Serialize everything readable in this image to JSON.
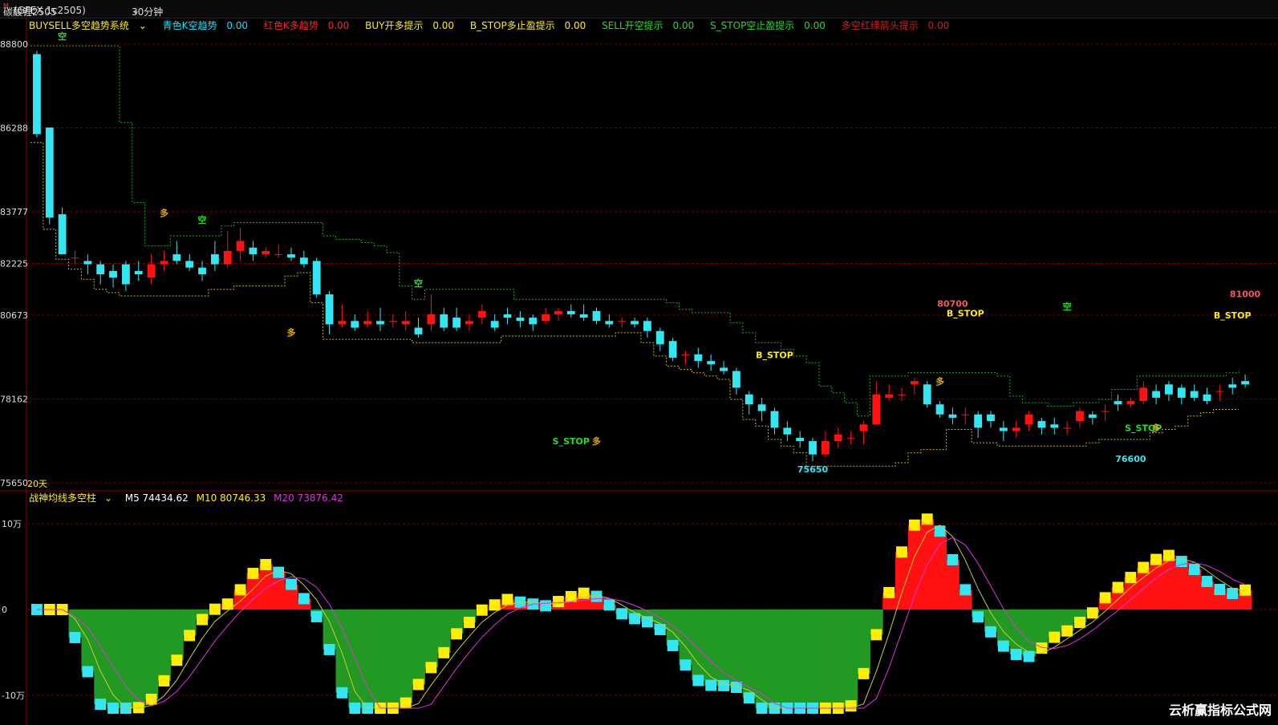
{
  "header": {
    "title": "碳酸锂2505",
    "title_superscript": "M",
    "contract": "(GFEX 1c2505)",
    "period": "30分钟"
  },
  "indicator_bar": {
    "system_name": "BUYSELL多空趋势系统",
    "items": [
      {
        "label": "青色K空趋势",
        "value": "0.00",
        "color": "#00e5ff"
      },
      {
        "label": "红色K多趋势",
        "value": "0.00",
        "color": "#ff2222"
      },
      {
        "label": "BUY开多提示",
        "value": "0.00",
        "color": "#ffee00"
      },
      {
        "label": "B_STOP多止盈提示",
        "value": "0.00",
        "color": "#ffee00"
      },
      {
        "label": "SELL开空提示",
        "value": "0.00",
        "color": "#22dd22"
      },
      {
        "label": "S_STOP空止盈提示",
        "value": "0.00",
        "color": "#22dd22"
      },
      {
        "label": "多空红绿箭头提示",
        "value": "0.00",
        "color": "#cc2222"
      }
    ]
  },
  "price_axis": [
    "88800",
    "86288",
    "83777",
    "82225",
    "80673",
    "78162",
    "75650"
  ],
  "period_label": "20天",
  "annotations": {
    "low1": "75650",
    "low2": "76600",
    "high1": "80700",
    "high2": "81000",
    "b_stop": "B_STOP",
    "s_stop": "S_STOP",
    "duo": "多",
    "kong": "空"
  },
  "sub_indicator": {
    "name": "战神均线多空柱",
    "m5": "M5 74434.62",
    "m10": "M10 80746.33",
    "m20": "M20 73876.42",
    "axis": [
      "10万",
      "0",
      "-10万"
    ]
  },
  "colors": {
    "up": "#ff1111",
    "down": "#33e6f2",
    "grid": "#7a0000",
    "yellow": "#ffee00",
    "green": "#229922",
    "magenta": "#dd33dd"
  },
  "watermark": "云析赢指标公式网",
  "chart_data": [
    {
      "type": "candlestick",
      "title": "碳酸锂2505 30分钟",
      "ylim": [
        75650,
        88800
      ],
      "candles": [
        [
          88500,
          86100,
          88600,
          86000
        ],
        [
          86300,
          83600,
          86300,
          83400
        ],
        [
          83700,
          82500,
          83900,
          82500
        ],
        [
          82400,
          82400,
          82600,
          82200
        ],
        [
          82300,
          82200,
          82500,
          81900
        ],
        [
          82200,
          81900,
          82300,
          81600
        ],
        [
          82000,
          81800,
          82200,
          81500
        ],
        [
          82200,
          81600,
          82300,
          81400
        ],
        [
          82000,
          81900,
          82300,
          81700
        ],
        [
          81800,
          82200,
          82500,
          81600
        ],
        [
          82200,
          82300,
          82600,
          82000
        ],
        [
          82500,
          82300,
          82900,
          82200
        ],
        [
          82300,
          82100,
          82500,
          82000
        ],
        [
          82100,
          81900,
          82300,
          81700
        ],
        [
          82500,
          82200,
          82900,
          82000
        ],
        [
          82200,
          82600,
          83200,
          82100
        ],
        [
          82600,
          82900,
          83300,
          82300
        ],
        [
          82700,
          82500,
          82900,
          82300
        ],
        [
          82500,
          82600,
          82700,
          82400
        ],
        [
          82500,
          82500,
          82800,
          82400
        ],
        [
          82500,
          82400,
          82700,
          82300
        ],
        [
          82400,
          82200,
          82600,
          82100
        ],
        [
          82300,
          81300,
          82400,
          81200
        ],
        [
          81300,
          80400,
          81400,
          80100
        ],
        [
          80400,
          80500,
          81000,
          80300
        ],
        [
          80500,
          80300,
          80700,
          80200
        ],
        [
          80400,
          80500,
          80800,
          80300
        ],
        [
          80500,
          80400,
          80900,
          80200
        ],
        [
          80500,
          80500,
          80700,
          80300
        ],
        [
          80400,
          80500,
          80800,
          80200
        ],
        [
          80300,
          80100,
          80600,
          80000
        ],
        [
          80400,
          80700,
          81300,
          80200
        ],
        [
          80700,
          80300,
          80900,
          80200
        ],
        [
          80600,
          80300,
          80900,
          80200
        ],
        [
          80400,
          80500,
          80700,
          80200
        ],
        [
          80600,
          80800,
          81000,
          80400
        ],
        [
          80500,
          80300,
          80700,
          80200
        ],
        [
          80700,
          80600,
          80900,
          80400
        ],
        [
          80600,
          80500,
          80800,
          80300
        ],
        [
          80600,
          80400,
          80700,
          80200
        ],
        [
          80500,
          80700,
          80900,
          80400
        ],
        [
          80700,
          80800,
          80900,
          80500
        ],
        [
          80800,
          80700,
          81000,
          80600
        ],
        [
          80700,
          80600,
          81000,
          80500
        ],
        [
          80800,
          80500,
          80900,
          80400
        ],
        [
          80500,
          80400,
          80700,
          80300
        ],
        [
          80500,
          80500,
          80600,
          80300
        ],
        [
          80500,
          80400,
          80600,
          80300
        ],
        [
          80500,
          80200,
          80600,
          80000
        ],
        [
          80200,
          79800,
          80300,
          79600
        ],
        [
          79900,
          79400,
          80000,
          79300
        ],
        [
          79500,
          79500,
          79600,
          79200
        ],
        [
          79500,
          79300,
          79700,
          79100
        ],
        [
          79300,
          79200,
          79500,
          79000
        ],
        [
          79100,
          79000,
          79300,
          78900
        ],
        [
          79000,
          78500,
          79100,
          78300
        ],
        [
          78300,
          78000,
          78400,
          77700
        ],
        [
          78000,
          77800,
          78200,
          77500
        ],
        [
          77800,
          77300,
          77900,
          77100
        ],
        [
          77300,
          77100,
          77500,
          76900
        ],
        [
          77000,
          76900,
          77200,
          76700
        ],
        [
          76900,
          76500,
          77000,
          76300
        ],
        [
          76500,
          76900,
          77200,
          76400
        ],
        [
          76900,
          77100,
          77300,
          76700
        ],
        [
          77000,
          77000,
          77200,
          76800
        ],
        [
          77200,
          77400,
          77500,
          76800
        ],
        [
          77400,
          78300,
          78700,
          77400
        ],
        [
          78200,
          78300,
          78600,
          78100
        ],
        [
          78300,
          78300,
          78500,
          78100
        ],
        [
          78600,
          78700,
          78800,
          78300
        ],
        [
          78600,
          78000,
          78700,
          77900
        ],
        [
          78000,
          77700,
          78100,
          77600
        ],
        [
          77700,
          77600,
          77900,
          77400
        ],
        [
          77700,
          77700,
          77900,
          77400
        ],
        [
          77700,
          77300,
          77800,
          77000
        ],
        [
          77700,
          77500,
          77800,
          77300
        ],
        [
          77300,
          77200,
          77500,
          76900
        ],
        [
          77200,
          77300,
          77500,
          77000
        ],
        [
          77400,
          77700,
          77800,
          77200
        ],
        [
          77500,
          77300,
          77600,
          77100
        ],
        [
          77400,
          77300,
          77600,
          77100
        ],
        [
          77300,
          77300,
          77500,
          77100
        ],
        [
          77500,
          77800,
          77900,
          77300
        ],
        [
          77700,
          77600,
          77800,
          77400
        ],
        [
          77800,
          77800,
          78000,
          77500
        ],
        [
          78100,
          78000,
          78300,
          77800
        ],
        [
          78000,
          78100,
          78200,
          77900
        ],
        [
          78100,
          78500,
          78700,
          78000
        ],
        [
          78400,
          78200,
          78600,
          78000
        ],
        [
          78600,
          78300,
          78700,
          78100
        ],
        [
          78500,
          78200,
          78600,
          78000
        ],
        [
          78400,
          78200,
          78600,
          78100
        ],
        [
          78300,
          78100,
          78500,
          78000
        ],
        [
          78400,
          78400,
          78600,
          78100
        ],
        [
          78600,
          78500,
          78800,
          78300
        ],
        [
          78700,
          78600,
          78900,
          78500
        ]
      ]
    },
    {
      "type": "bar",
      "title": "战神均线多空柱",
      "series": [
        {
          "name": "M5",
          "last": 74434.62
        },
        {
          "name": "M10",
          "last": 80746.33
        },
        {
          "name": "M20",
          "last": 73876.42
        }
      ],
      "ylim": [
        -100000,
        100000
      ]
    }
  ]
}
